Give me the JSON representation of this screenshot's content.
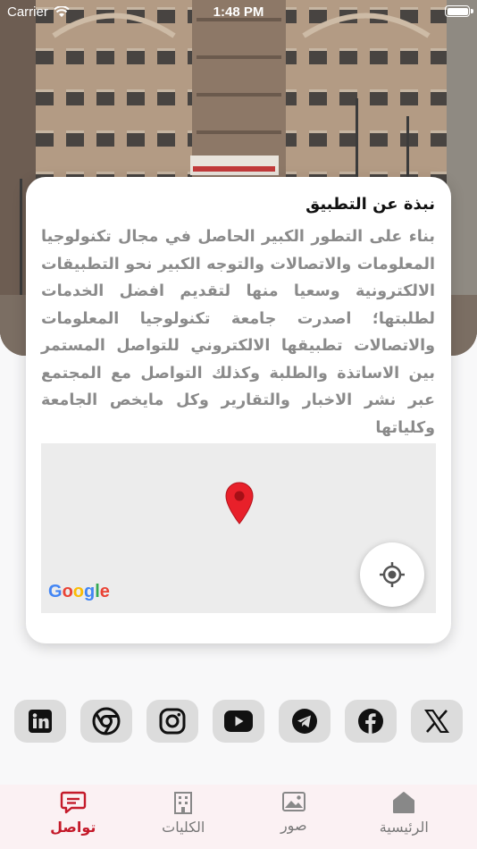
{
  "status_bar": {
    "carrier": "Carrier",
    "time": "1:48 PM"
  },
  "about": {
    "title": "نبذة عن التطبيق",
    "body": "بناء على التطور الكبير الحاصل في مجال تكنولوجيا المعلومات والاتصالات والتوجه الكبير نحو التطبيقات الالكترونية وسعيا منها لتقديم افضل الخدمات لطلبتها؛ اصدرت جامعة تكنولوجيا المعلومات والاتصالات تطبيقها الالكتروني للتواصل المستمر بين الاساتذة والطلبة وكذلك التواصل مع المجتمع عبر نشر الاخبار والتقارير وكل مايخص الجامعة وكلياتها"
  },
  "map": {
    "attribution": "Google"
  },
  "social": [
    {
      "name": "linkedin-icon"
    },
    {
      "name": "chrome-icon"
    },
    {
      "name": "instagram-icon"
    },
    {
      "name": "youtube-icon"
    },
    {
      "name": "telegram-icon"
    },
    {
      "name": "facebook-icon"
    },
    {
      "name": "x-icon"
    }
  ],
  "tabs": [
    {
      "label": "الرئيسية",
      "icon": "home-icon",
      "active": false
    },
    {
      "label": "صور",
      "icon": "image-icon",
      "active": false
    },
    {
      "label": "الكليات",
      "icon": "building-icon",
      "active": false
    },
    {
      "label": "تواصل",
      "icon": "chat-icon",
      "active": true
    }
  ],
  "colors": {
    "accent": "#c41a2a",
    "tab_bg": "#fbf1f3",
    "social_bg": "#dcdcdc"
  }
}
